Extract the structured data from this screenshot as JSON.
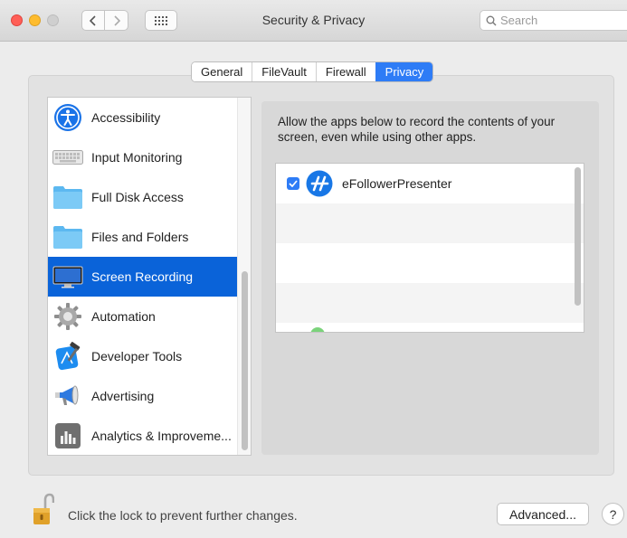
{
  "window": {
    "title": "Security & Privacy",
    "search_placeholder": "Search"
  },
  "tabs": [
    {
      "label": "General",
      "active": false
    },
    {
      "label": "FileVault",
      "active": false
    },
    {
      "label": "Firewall",
      "active": false
    },
    {
      "label": "Privacy",
      "active": true
    }
  ],
  "sidebar": {
    "items": [
      {
        "label": "Accessibility",
        "icon": "accessibility-icon",
        "selected": false
      },
      {
        "label": "Input Monitoring",
        "icon": "keyboard-icon",
        "selected": false
      },
      {
        "label": "Full Disk Access",
        "icon": "folder-icon",
        "selected": false
      },
      {
        "label": "Files and Folders",
        "icon": "folder-icon",
        "selected": false
      },
      {
        "label": "Screen Recording",
        "icon": "display-icon",
        "selected": true
      },
      {
        "label": "Automation",
        "icon": "gear-icon",
        "selected": false
      },
      {
        "label": "Developer Tools",
        "icon": "hammer-icon",
        "selected": false
      },
      {
        "label": "Advertising",
        "icon": "megaphone-icon",
        "selected": false
      },
      {
        "label": "Analytics & Improveme...",
        "icon": "bar-chart-icon",
        "selected": false
      }
    ]
  },
  "main": {
    "description": "Allow the apps below to record the contents of your screen, even while using other apps.",
    "apps": [
      {
        "name": "eFollowerPresenter",
        "checked": true
      }
    ]
  },
  "footer": {
    "lock_text": "Click the lock to prevent further changes.",
    "advanced_label": "Advanced...",
    "help_label": "?"
  },
  "colors": {
    "accent": "#2e7cf6",
    "selection": "#0a63d9"
  }
}
